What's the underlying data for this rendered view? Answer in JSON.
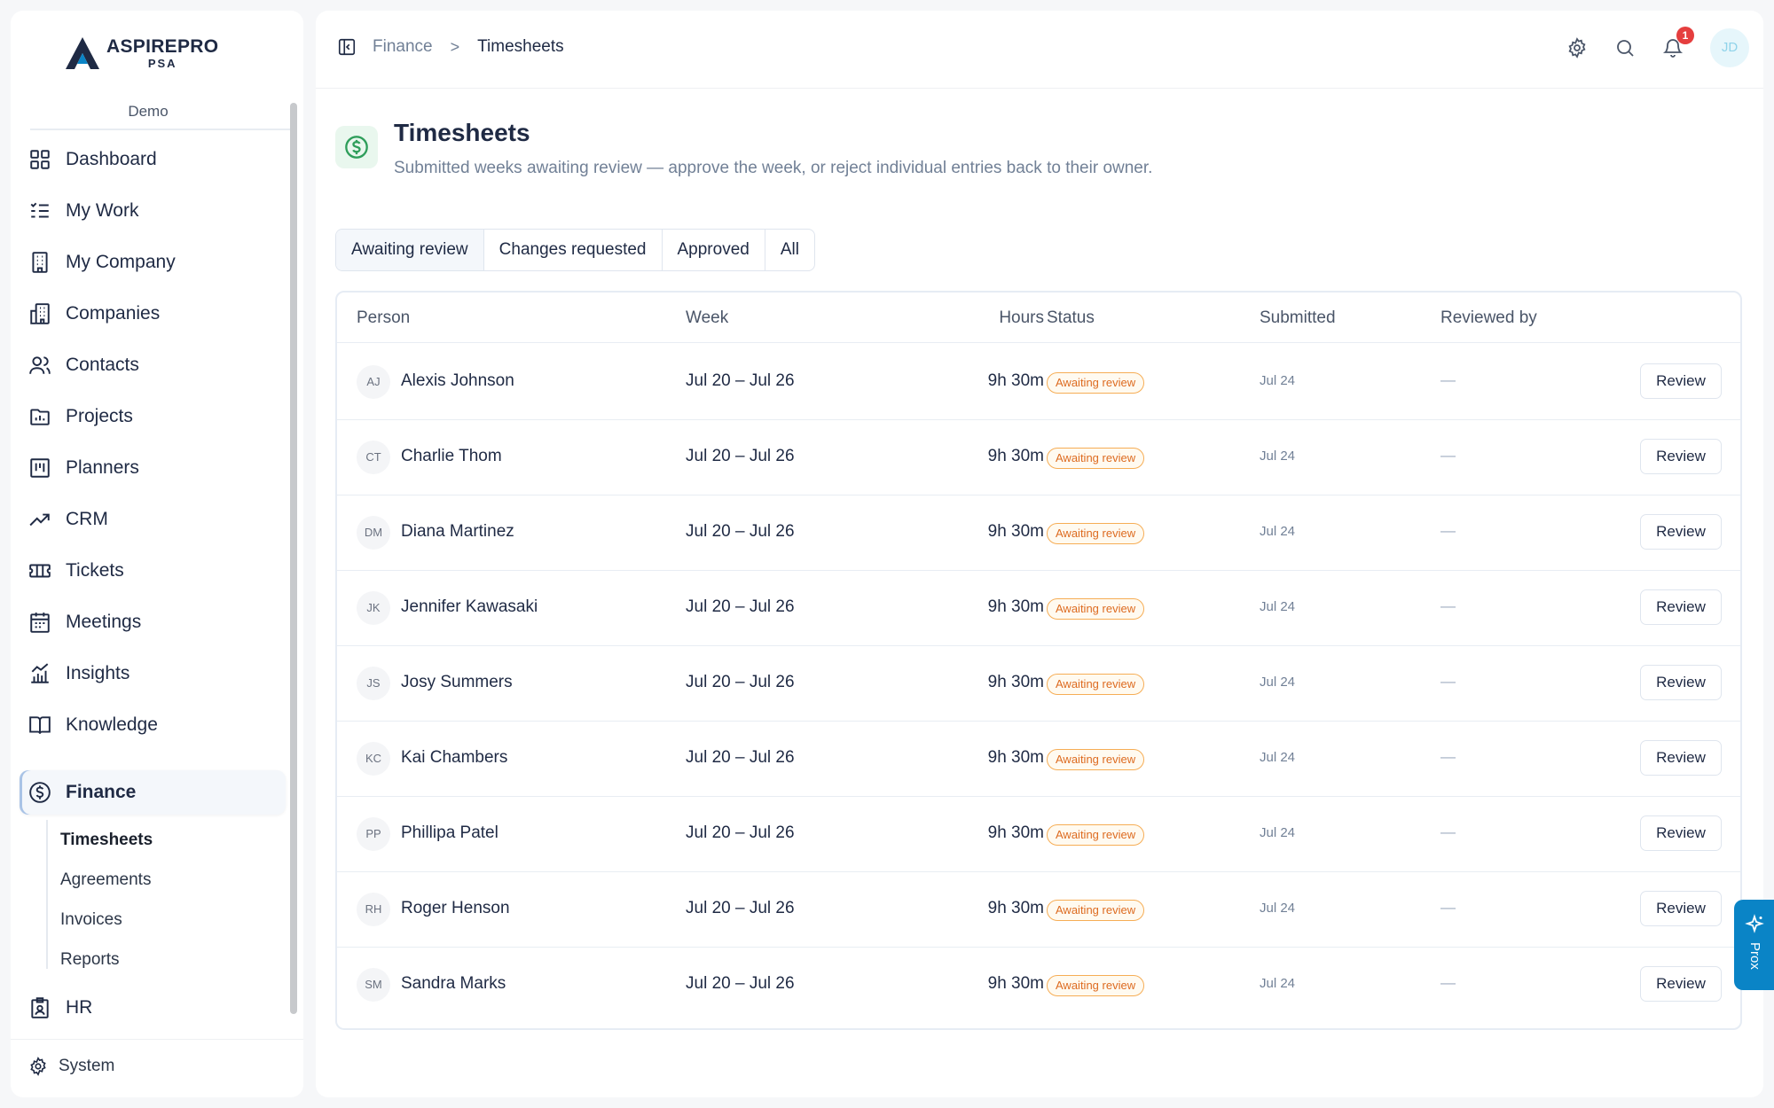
{
  "brand": {
    "name": "ASPIREPRO",
    "sub": "PSA"
  },
  "workspace": "Demo",
  "sidebar": {
    "items": [
      {
        "label": "Dashboard",
        "icon": "grid-icon"
      },
      {
        "label": "My Work",
        "icon": "list-check-icon"
      },
      {
        "label": "My Company",
        "icon": "building-icon"
      },
      {
        "label": "Companies",
        "icon": "buildings-icon"
      },
      {
        "label": "Contacts",
        "icon": "users-icon"
      },
      {
        "label": "Projects",
        "icon": "folder-icon"
      },
      {
        "label": "Planners",
        "icon": "planner-icon"
      },
      {
        "label": "CRM",
        "icon": "trending-up-icon"
      },
      {
        "label": "Tickets",
        "icon": "ticket-icon"
      },
      {
        "label": "Meetings",
        "icon": "calendar-icon"
      },
      {
        "label": "Insights",
        "icon": "bar-chart-icon"
      },
      {
        "label": "Knowledge",
        "icon": "book-icon"
      },
      {
        "label": "Finance",
        "icon": "dollar-circle-icon"
      },
      {
        "label": "HR",
        "icon": "id-badge-icon"
      }
    ],
    "finance_sub": [
      "Timesheets",
      "Agreements",
      "Invoices",
      "Reports"
    ],
    "system_label": "System"
  },
  "breadcrumb": {
    "parent": "Finance",
    "separator": ">",
    "current": "Timesheets"
  },
  "topbar": {
    "notification_count": "1",
    "user_initials": "JD"
  },
  "page": {
    "title": "Timesheets",
    "subtitle": "Submitted weeks awaiting review — approve the week, or reject individual entries back to their owner."
  },
  "tabs": [
    "Awaiting review",
    "Changes requested",
    "Approved",
    "All"
  ],
  "table": {
    "columns": [
      "Person",
      "Week",
      "Hours",
      "Status",
      "Submitted",
      "Reviewed by"
    ],
    "action_label": "Review",
    "rows": [
      {
        "initials": "AJ",
        "name": "Alexis Johnson",
        "week": "Jul 20 – Jul 26",
        "hours": "9h 30m",
        "status": "Awaiting review",
        "submitted": "Jul 24",
        "reviewed_by": "—"
      },
      {
        "initials": "CT",
        "name": "Charlie Thom",
        "week": "Jul 20 – Jul 26",
        "hours": "9h 30m",
        "status": "Awaiting review",
        "submitted": "Jul 24",
        "reviewed_by": "—"
      },
      {
        "initials": "DM",
        "name": "Diana Martinez",
        "week": "Jul 20 – Jul 26",
        "hours": "9h 30m",
        "status": "Awaiting review",
        "submitted": "Jul 24",
        "reviewed_by": "—"
      },
      {
        "initials": "JK",
        "name": "Jennifer Kawasaki",
        "week": "Jul 20 – Jul 26",
        "hours": "9h 30m",
        "status": "Awaiting review",
        "submitted": "Jul 24",
        "reviewed_by": "—"
      },
      {
        "initials": "JS",
        "name": "Josy Summers",
        "week": "Jul 20 – Jul 26",
        "hours": "9h 30m",
        "status": "Awaiting review",
        "submitted": "Jul 24",
        "reviewed_by": "—"
      },
      {
        "initials": "KC",
        "name": "Kai Chambers",
        "week": "Jul 20 – Jul 26",
        "hours": "9h 30m",
        "status": "Awaiting review",
        "submitted": "Jul 24",
        "reviewed_by": "—"
      },
      {
        "initials": "PP",
        "name": "Phillipa Patel",
        "week": "Jul 20 – Jul 26",
        "hours": "9h 30m",
        "status": "Awaiting review",
        "submitted": "Jul 24",
        "reviewed_by": "—"
      },
      {
        "initials": "RH",
        "name": "Roger Henson",
        "week": "Jul 20 – Jul 26",
        "hours": "9h 30m",
        "status": "Awaiting review",
        "submitted": "Jul 24",
        "reviewed_by": "—"
      },
      {
        "initials": "SM",
        "name": "Sandra Marks",
        "week": "Jul 20 – Jul 26",
        "hours": "9h 30m",
        "status": "Awaiting review",
        "submitted": "Jul 24",
        "reviewed_by": "—"
      }
    ]
  },
  "ai_assistant": {
    "label": "Prox"
  },
  "colors": {
    "accent": "#0a84c6",
    "status_warning": "#dd6b20",
    "finance_green": "#2f9e5b"
  }
}
